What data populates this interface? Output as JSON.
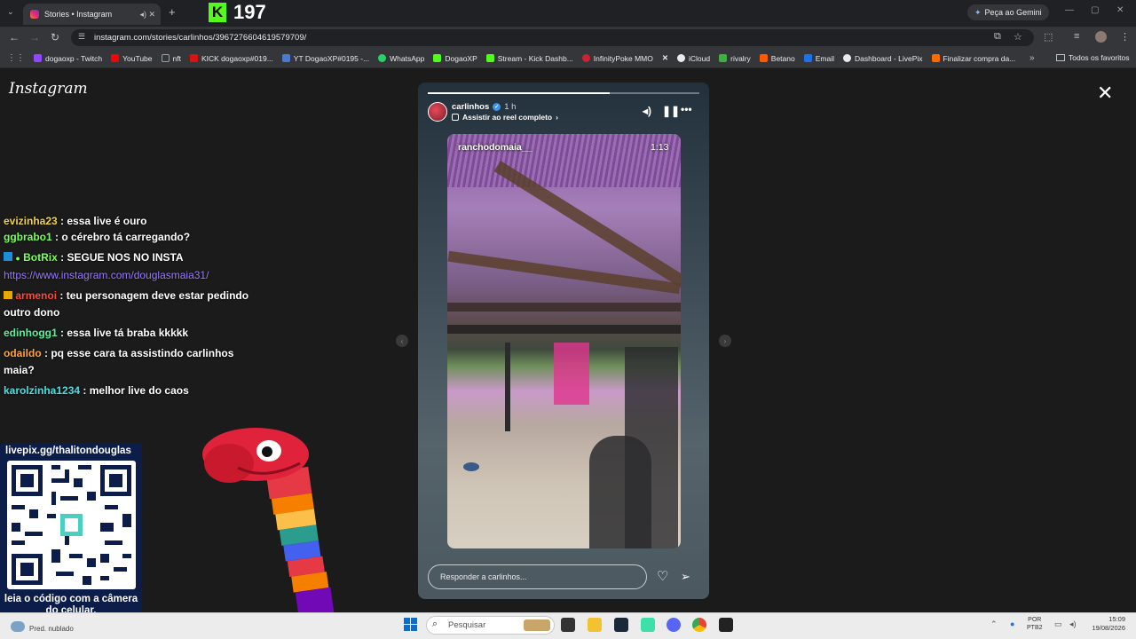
{
  "browser": {
    "tab_title": "Stories • Instagram",
    "kick_count": "197",
    "gemini_label": "Peça ao Gemini",
    "url": "instagram.com/stories/carlinhos/3967276604619579709/",
    "bookmarks": [
      {
        "label": "dogaoxp - Twitch",
        "color": "#9146ff"
      },
      {
        "label": "YouTube",
        "color": "#ff0000"
      },
      {
        "label": "nft",
        "color": "#9aa0a6"
      },
      {
        "label": "KICK dogaoxp#019...",
        "color": "#d11"
      },
      {
        "label": "YT DogaoXP#0195 -...",
        "color": "#4a7bd0"
      },
      {
        "label": "WhatsApp",
        "color": "#25d366"
      },
      {
        "label": "DogaoXP",
        "color": "#53fc18"
      },
      {
        "label": "Stream - Kick Dashb...",
        "color": "#53fc18"
      },
      {
        "label": "InfinityPoke MMO",
        "color": "#cc2233"
      },
      {
        "label": "",
        "color": "#000000"
      },
      {
        "label": "iCloud",
        "color": "#e8eaed"
      },
      {
        "label": "rivalry",
        "color": "#3cb043"
      },
      {
        "label": "Betano",
        "color": "#ff5a00"
      },
      {
        "label": "Email",
        "color": "#1a73e8"
      },
      {
        "label": "Dashboard - LivePix",
        "color": "#e8eaed"
      },
      {
        "label": "Finalizar compra da...",
        "color": "#ff6a00"
      }
    ],
    "all_bookmarks": "Todos os favoritos"
  },
  "page": {
    "logo": "Instagram",
    "chat": [
      {
        "user": "evizinha23",
        "user_color": "#f0d24a",
        "text": ": essa live é ouro"
      },
      {
        "user": "ggbrabo1",
        "user_color": "#7bff5a",
        "text": ": o cérebro tá carregando?"
      },
      {
        "user": "BotRix",
        "user_color": "#7bff5a",
        "text": ": SEGUE NOS NO INSTA"
      },
      {
        "user": "",
        "user_color": "#9b7cff",
        "text": "https://www.instagram.com/douglasmaia31/"
      },
      {
        "user": "armenoi",
        "user_color": "#ff4a3a",
        "text": ": teu personagem deve estar pedindo outro dono"
      },
      {
        "user": "edinhogg1",
        "user_color": "#5bf0a0",
        "text": ": essa live tá braba kkkkk"
      },
      {
        "user": "odaildo",
        "user_color": "#ffa43a",
        "text": ": pq esse cara ta assistindo carlinhos maia?"
      },
      {
        "user": "karolzinha1234",
        "user_color": "#48e0e0",
        "text": ": melhor live do caos"
      }
    ],
    "qr_top": "livepix.gg/thalitondouglas",
    "qr_bottom": "leia o código com a câmera do celular."
  },
  "story": {
    "username": "carlinhos",
    "time_ago": "1 h",
    "reel_link": "Assistir ao reel completo",
    "video_user": "ranchodomaia__",
    "video_time": "1:13",
    "reply_placeholder": "Responder a carlinhos...",
    "progress": 0.67
  },
  "taskbar": {
    "weather": "Pred. nublado",
    "search": "Pesquisar",
    "lang1": "POR",
    "lang2": "PTB2",
    "time": "15:09",
    "date": "19/08/2026"
  }
}
